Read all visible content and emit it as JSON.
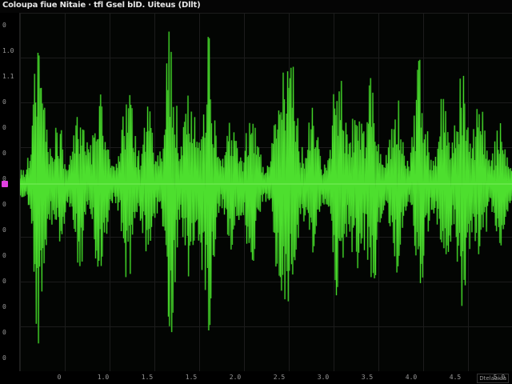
{
  "window": {
    "title": "Coloupa fiue Nitaie · tfl Gsel blD. Uiteus (Dllt)"
  },
  "y_axis": {
    "ticks": [
      "0",
      "1.0",
      "1.1",
      "0",
      "0",
      "0",
      "0",
      "0",
      "0",
      "0",
      "0",
      "0",
      "0",
      "0"
    ]
  },
  "x_axis": {
    "ticks": [
      "0",
      "1.0",
      "1.5",
      "1.5",
      "2.0",
      "2.5",
      "3.0",
      "3.5",
      "4.0",
      "4.5",
      "5.0"
    ]
  },
  "status": {
    "label": "Dtelauiua"
  },
  "colors": {
    "background": "#000000",
    "waveform": "#4ddf2e",
    "waveform_glow": "#1f8f14",
    "grid": "#1c1c1c",
    "marker": "#e040e0"
  },
  "icons": {
    "cursor_marker": "magenta-square-marker"
  }
}
